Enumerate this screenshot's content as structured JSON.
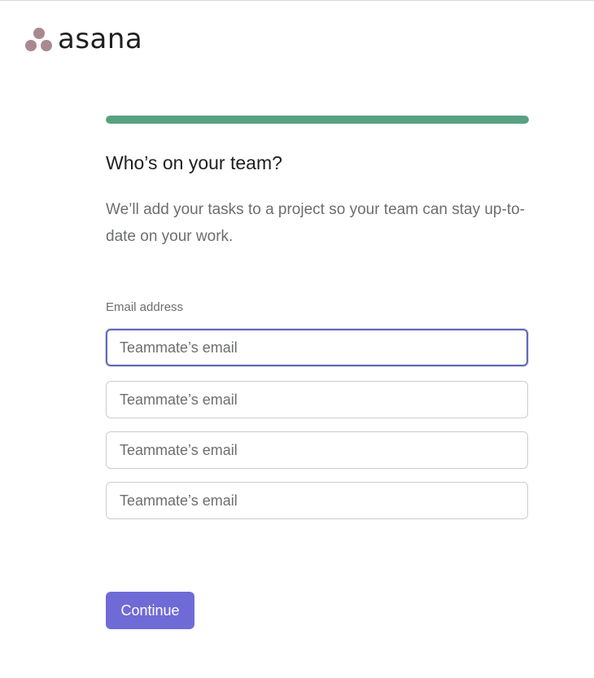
{
  "brand": {
    "wordmark": "asana",
    "logo_icon": "asana-three-dots-logo",
    "logo_color": "#a9898e"
  },
  "progress": {
    "fraction": 1.0,
    "color": "#58a182"
  },
  "page": {
    "title": "Who’s on your team?",
    "subtitle": "We’ll add your tasks to a project so your team can stay up-to-date on your work."
  },
  "form": {
    "email_label": "Email address",
    "inputs": [
      {
        "placeholder": "Teammate’s email",
        "value": "",
        "focused": true
      },
      {
        "placeholder": "Teammate’s email",
        "value": ""
      },
      {
        "placeholder": "Teammate’s email",
        "value": ""
      },
      {
        "placeholder": "Teammate’s email",
        "value": ""
      }
    ],
    "focus_color": "#6068b6"
  },
  "actions": {
    "continue_label": "Continue",
    "continue_color": "#6f6bd6"
  }
}
